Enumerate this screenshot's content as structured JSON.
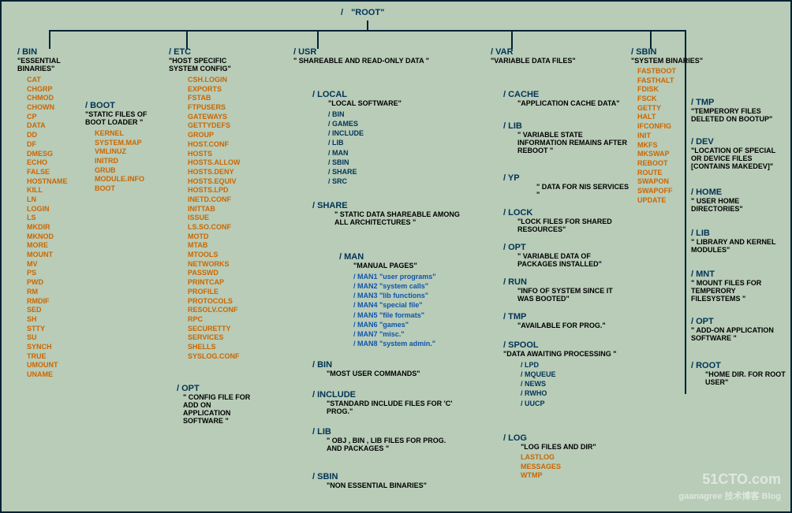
{
  "root": {
    "path": "/",
    "label": "\"ROOT\""
  },
  "bin": {
    "title": "/ BIN",
    "desc": "\"ESSENTIAL BINARIES\"",
    "items": [
      "CAT",
      "CHGRP",
      "CHMOD",
      "CHOWN",
      "CP",
      "DATA",
      "DD",
      "DF",
      "DMESG",
      "ECHO",
      "FALSE",
      "HOSTNAME",
      "KILL",
      "LN",
      "LOGIN",
      "LS",
      "MKDIR",
      "MKNOD",
      "MORE",
      "MOUNT",
      "MV",
      "PS",
      "PWD",
      "RM",
      "RMDIF",
      "SED",
      "SH",
      "STTY",
      "SU",
      "SYNCH",
      "TRUE",
      "UMOUNT",
      "UNAME"
    ]
  },
  "boot": {
    "title": "/ BOOT",
    "desc": "\"STATIC FILES OF BOOT LOADER \"",
    "items": [
      "KERNEL",
      "SYSTEM.MAP",
      "VMLINUZ",
      "INITRD",
      "GRUB",
      "MODULE.INFO",
      "BOOT"
    ]
  },
  "etc": {
    "title": "/ ETC",
    "desc": "\"HOST SPECIFIC SYSTEM CONFIG\"",
    "items": [
      "CSH.LOGIN",
      "EXPORTS",
      "FSTAB",
      "FTPUSERS",
      "GATEWAYS",
      "GETTYDEFS",
      "GROUP",
      "HOST.CONF",
      "HOSTS",
      "HOSTS.ALLOW",
      "HOSTS.DENY",
      "HOSTS.EQUIV",
      "HOSTS.LPD",
      "INETD.CONF",
      "INITTAB",
      "ISSUE",
      "LS.SO.CONF",
      "MOTD",
      "MTAB",
      "MTOOLS",
      "NETWORKS",
      "PASSWD",
      "PRINTCAP",
      "PROFILE",
      "PROTOCOLS",
      "RESOLV.CONF",
      "RPC",
      "SECURETTY",
      "SERVICES",
      "SHELLS",
      "SYSLOG.CONF"
    ]
  },
  "opt_top": {
    "title": "/ OPT",
    "desc": "\" CONFIG FILE FOR ADD ON APPLICATION SOFTWARE \""
  },
  "usr": {
    "title": "/ USR",
    "desc": "\" SHAREABLE AND READ-ONLY DATA \"",
    "local": {
      "title": "/ LOCAL",
      "desc": "\"LOCAL SOFTWARE\"",
      "subs": [
        "/ BIN",
        "/ GAMES",
        "/ INCLUDE",
        "/ LIB",
        "/ MAN",
        "/ SBIN",
        "/ SHARE",
        "/ SRC"
      ]
    },
    "share": {
      "title": "/ SHARE",
      "desc": "\" STATIC DATA SHAREABLE AMONG ALL ARCHITECTURES \"",
      "man": {
        "title": "/ MAN",
        "desc": "\"MANUAL PAGES\"",
        "subs": [
          "/ MAN1 \"user programs\"",
          "/ MAN2 \"system calls\"",
          "/ MAN3 \"lib functions\"",
          "/ MAN4 \"special file\"",
          "/ MAN5 \"file formats\"",
          "/ MAN6 \"games\"",
          "/ MAN7 \"misc.\"",
          "/ MAN8 \"system admin.\""
        ]
      }
    },
    "bin2": {
      "title": "/ BIN",
      "desc": "\"MOST USER COMMANDS\""
    },
    "include": {
      "title": "/ INCLUDE",
      "desc": "\"STANDARD INCLUDE FILES FOR  'C' PROG.\""
    },
    "lib": {
      "title": "/ LIB",
      "desc": "\" OBJ , BIN , LIB FILES FOR PROG. AND PACKAGES \""
    },
    "sbin": {
      "title": "/ SBIN",
      "desc": "\"NON ESSENTIAL BINARIES\""
    }
  },
  "var": {
    "title": "/ VAR",
    "desc": "\"VARIABLE DATA FILES\"",
    "cache": {
      "title": "/ CACHE",
      "desc": "\"APPLICATION CACHE DATA\""
    },
    "lib": {
      "title": "/ LIB",
      "desc": "\" VARIABLE STATE INFORMATION REMAINS  AFTER REBOOT \""
    },
    "yp": {
      "title": "/ YP",
      "desc": "\" DATA FOR NIS SERVICES \""
    },
    "lock": {
      "title": "/ LOCK",
      "desc": "\"LOCK FILES FOR SHARED RESOURCES\""
    },
    "opt": {
      "title": "/ OPT",
      "desc": "\" VARIABLE DATA OF PACKAGES INSTALLED\""
    },
    "run": {
      "title": "/ RUN",
      "desc": "\"INFO OF SYSTEM SINCE IT WAS BOOTED\""
    },
    "tmp": {
      "title": "/ TMP",
      "desc": "\"AVAILABLE FOR PROG.\""
    },
    "spool": {
      "title": "/ SPOOL",
      "desc": "\"DATA AWAITING PROCESSING \"",
      "subs": [
        "/ LPD",
        "/ MQUEUE",
        "/ NEWS",
        "/ RWHO",
        "/ UUCP"
      ]
    },
    "log": {
      "title": "/ LOG",
      "desc": "\"LOG FILES AND DIR\"",
      "items": [
        "LASTLOG",
        "MESSAGES",
        "WTMP"
      ]
    }
  },
  "sbin": {
    "title": "/ SBIN",
    "desc": "\"SYSTEM BINARIES\"",
    "items": [
      "FASTBOOT",
      "FASTHALT",
      "FDISK",
      "FSCK",
      "GETTY",
      "HALT",
      "IFCONFIG",
      "INIT",
      "MKFS",
      "MKSWAP",
      "REBOOT",
      "ROUTE",
      "SWAPON",
      "SWAPOFF",
      "UPDATE"
    ]
  },
  "right": {
    "tmp": {
      "title": "/ TMP",
      "desc": "\"TEMPERORY FILES DELETED ON BOOTUP\""
    },
    "dev": {
      "title": "/ DEV",
      "desc": "\"LOCATION OF SPECIAL OR DEVICE FILES [CONTAINS MAKEDEV]\""
    },
    "home": {
      "title": "/ HOME",
      "desc": "\" USER HOME DIRECTORIES\""
    },
    "lib": {
      "title": "/ LIB",
      "desc": "\" LIBRARY AND KERNEL MODULES\""
    },
    "mnt": {
      "title": "/ MNT",
      "desc": "\"  MOUNT FILES FOR TEMPERORY FILESYSTEMS \""
    },
    "opt": {
      "title": "/ OPT",
      "desc": "\" ADD-ON APPLICATION SOFTWARE \""
    },
    "root": {
      "title": "/ ROOT",
      "desc": "\"HOME DIR. FOR ROOT USER\""
    }
  },
  "watermark1": "51CTO.com",
  "watermark2": "gaanagree 技术博客  Blog"
}
